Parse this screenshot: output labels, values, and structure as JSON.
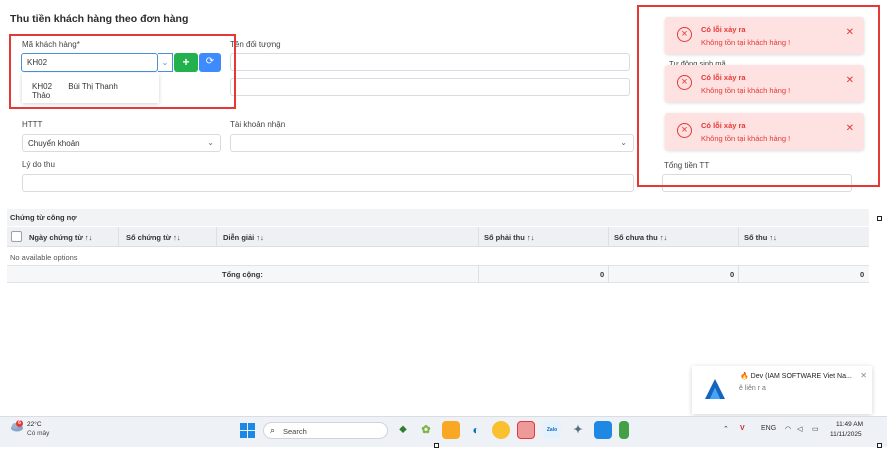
{
  "page": {
    "title": "Thu tiền khách hàng theo đơn hàng"
  },
  "form": {
    "ma_khach_hang": {
      "label": "Mã khách hàng*",
      "value": "KH02"
    },
    "ten_doi_tuong": {
      "label": "Tên đối tượng"
    },
    "dropdown_option": {
      "code": "KH02",
      "name": "Bùi Thị Thanh Thảo"
    },
    "httt": {
      "label": "HTTT",
      "value": "Chuyển khoản"
    },
    "tai_khoan_nhan": {
      "label": "Tài khoản nhận",
      "value": ""
    },
    "ly_do_thu": {
      "label": "Lý do thu",
      "value": ""
    },
    "tu_dong_sinh_ma": {
      "label": "Tự động sinh mã"
    },
    "tong_tien_tt": {
      "label": "Tổng tiền TT"
    }
  },
  "table": {
    "section_title": "Chứng từ công nợ",
    "sort_glyph": "↑↓",
    "columns": [
      "Ngày chứng từ",
      "Số chứng từ",
      "Diễn giải",
      "Số phải thu",
      "Số chưa thu",
      "Số thu"
    ],
    "empty_text": "No available options",
    "footer": {
      "label": "Tổng cộng:",
      "so_phai_thu": "0",
      "so_chua_thu": "0",
      "so_thu": "0"
    }
  },
  "toasts": [
    {
      "title": "Có lỗi xảy ra",
      "message": "Không tồn tại khách hàng !"
    },
    {
      "title": "Có lỗi xảy ra",
      "message": "Không tồn tại khách hàng !"
    },
    {
      "title": "Có lỗi xảy ra",
      "message": "Không tồn tại khách hàng !"
    }
  ],
  "notification": {
    "title": "Dev (IAM SOFTWARE Viet Na...",
    "subtitle": "ê liên r a"
  },
  "taskbar": {
    "weather": {
      "temp": "22°C",
      "condition": "Có mây",
      "badge": "6"
    },
    "search_placeholder": "Search",
    "tray": {
      "lang": "ENG"
    },
    "clock": {
      "time": "11:49 AM",
      "date": "11/11/2025"
    }
  },
  "colors": {
    "error": "#e53935",
    "toast_bg": "#fde2e1",
    "add_button": "#22b14c",
    "refresh_button": "#3d8bfd",
    "focus_border": "#4a90d9"
  },
  "icons": [
    "chevron-down-icon",
    "plus-icon",
    "refresh-icon",
    "error-circle-icon",
    "close-icon",
    "windows-start-icon",
    "search-icon",
    "wifi-icon",
    "volume-icon",
    "battery-icon"
  ]
}
